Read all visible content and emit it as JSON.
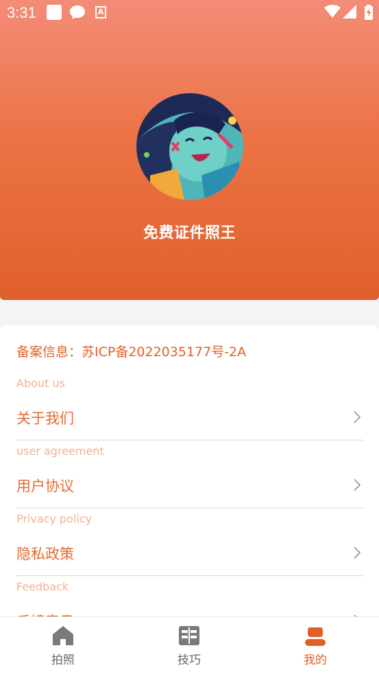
{
  "status_bar": {
    "time": "3:31",
    "icons": [
      "square-icon",
      "chat-icon",
      "font-a-icon",
      "wifi-icon",
      "signal-icon",
      "battery-icon"
    ]
  },
  "header": {
    "app_name": "免费证件照王",
    "gradient_colors": [
      "#f38c77",
      "#e0602a"
    ]
  },
  "card": {
    "icp_text": "备案信息：苏ICP备2022035177号-2A",
    "sections": [
      {
        "en": "About us",
        "label": "关于我们"
      },
      {
        "en": "user agreement",
        "label": "用户协议"
      },
      {
        "en": "Privacy policy",
        "label": "隐私政策"
      },
      {
        "en": "Feedback",
        "label": "反馈意见"
      }
    ]
  },
  "bottom_nav": {
    "items": [
      {
        "label": "拍照",
        "icon": "home-icon",
        "active": false
      },
      {
        "label": "技巧",
        "icon": "grid-book-icon",
        "active": false
      },
      {
        "label": "我的",
        "icon": "person-icon",
        "active": true
      }
    ],
    "active_color": "#e0602a",
    "inactive_color": "#666666"
  }
}
